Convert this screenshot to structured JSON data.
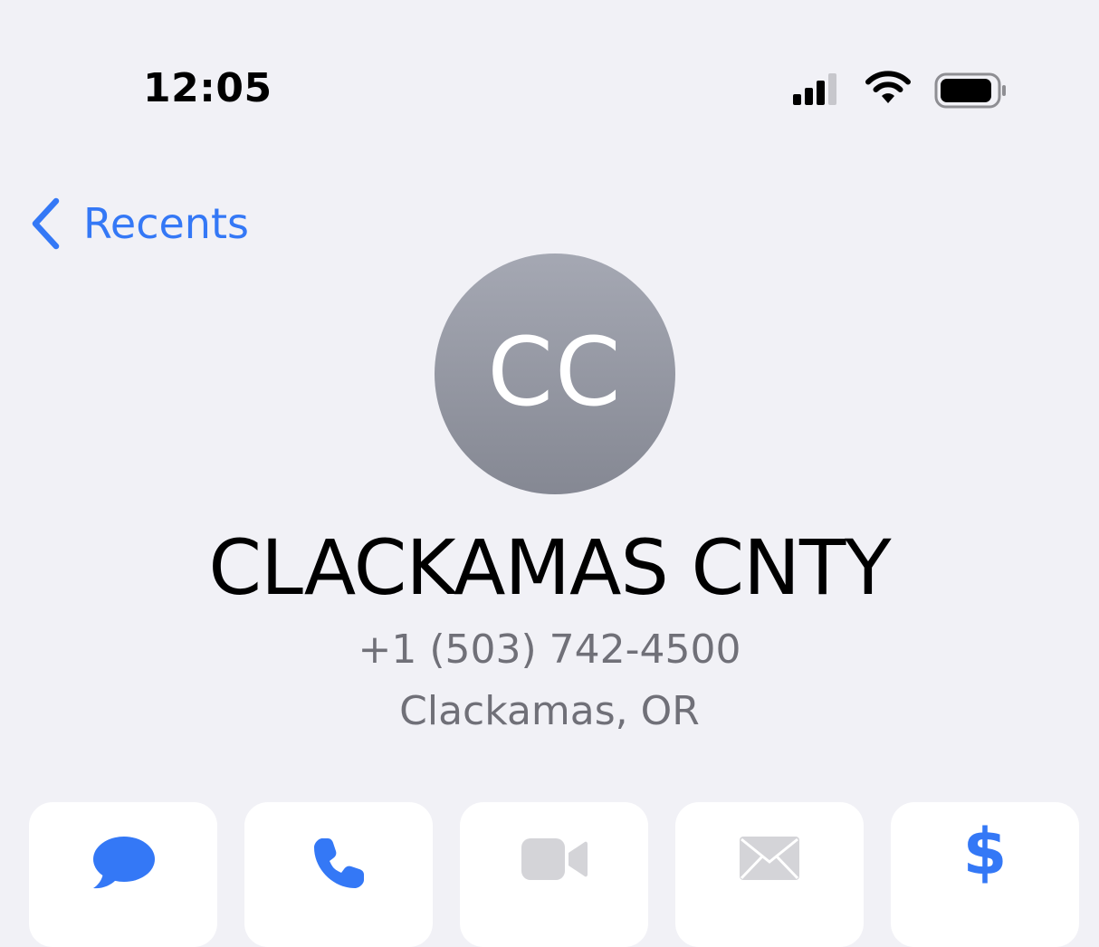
{
  "status_bar": {
    "time": "12:05",
    "icons": [
      "cellular-signal-icon",
      "wifi-icon",
      "battery-icon"
    ]
  },
  "nav": {
    "back_label": "Recents",
    "back_icon": "chevron-left-icon"
  },
  "contact": {
    "initials": "CC",
    "name": "CLACKAMAS CNTY",
    "phone": "+1 (503) 742-4500",
    "location": "Clackamas, OR"
  },
  "actions": [
    {
      "id": "message",
      "icon": "message-bubble-icon",
      "enabled": true
    },
    {
      "id": "call",
      "icon": "phone-icon",
      "enabled": true
    },
    {
      "id": "video",
      "icon": "video-camera-icon",
      "enabled": false
    },
    {
      "id": "mail",
      "icon": "envelope-icon",
      "enabled": false
    },
    {
      "id": "pay",
      "icon": "dollar-sign-icon",
      "glyph": "$",
      "enabled": true
    }
  ],
  "colors": {
    "background": "#f1f1f6",
    "accent": "#3478f6",
    "disabled_icon": "#d4d4d8",
    "secondary_text": "#707078",
    "avatar_gradient_top": "#a5a8b3",
    "avatar_gradient_bottom": "#858893"
  }
}
